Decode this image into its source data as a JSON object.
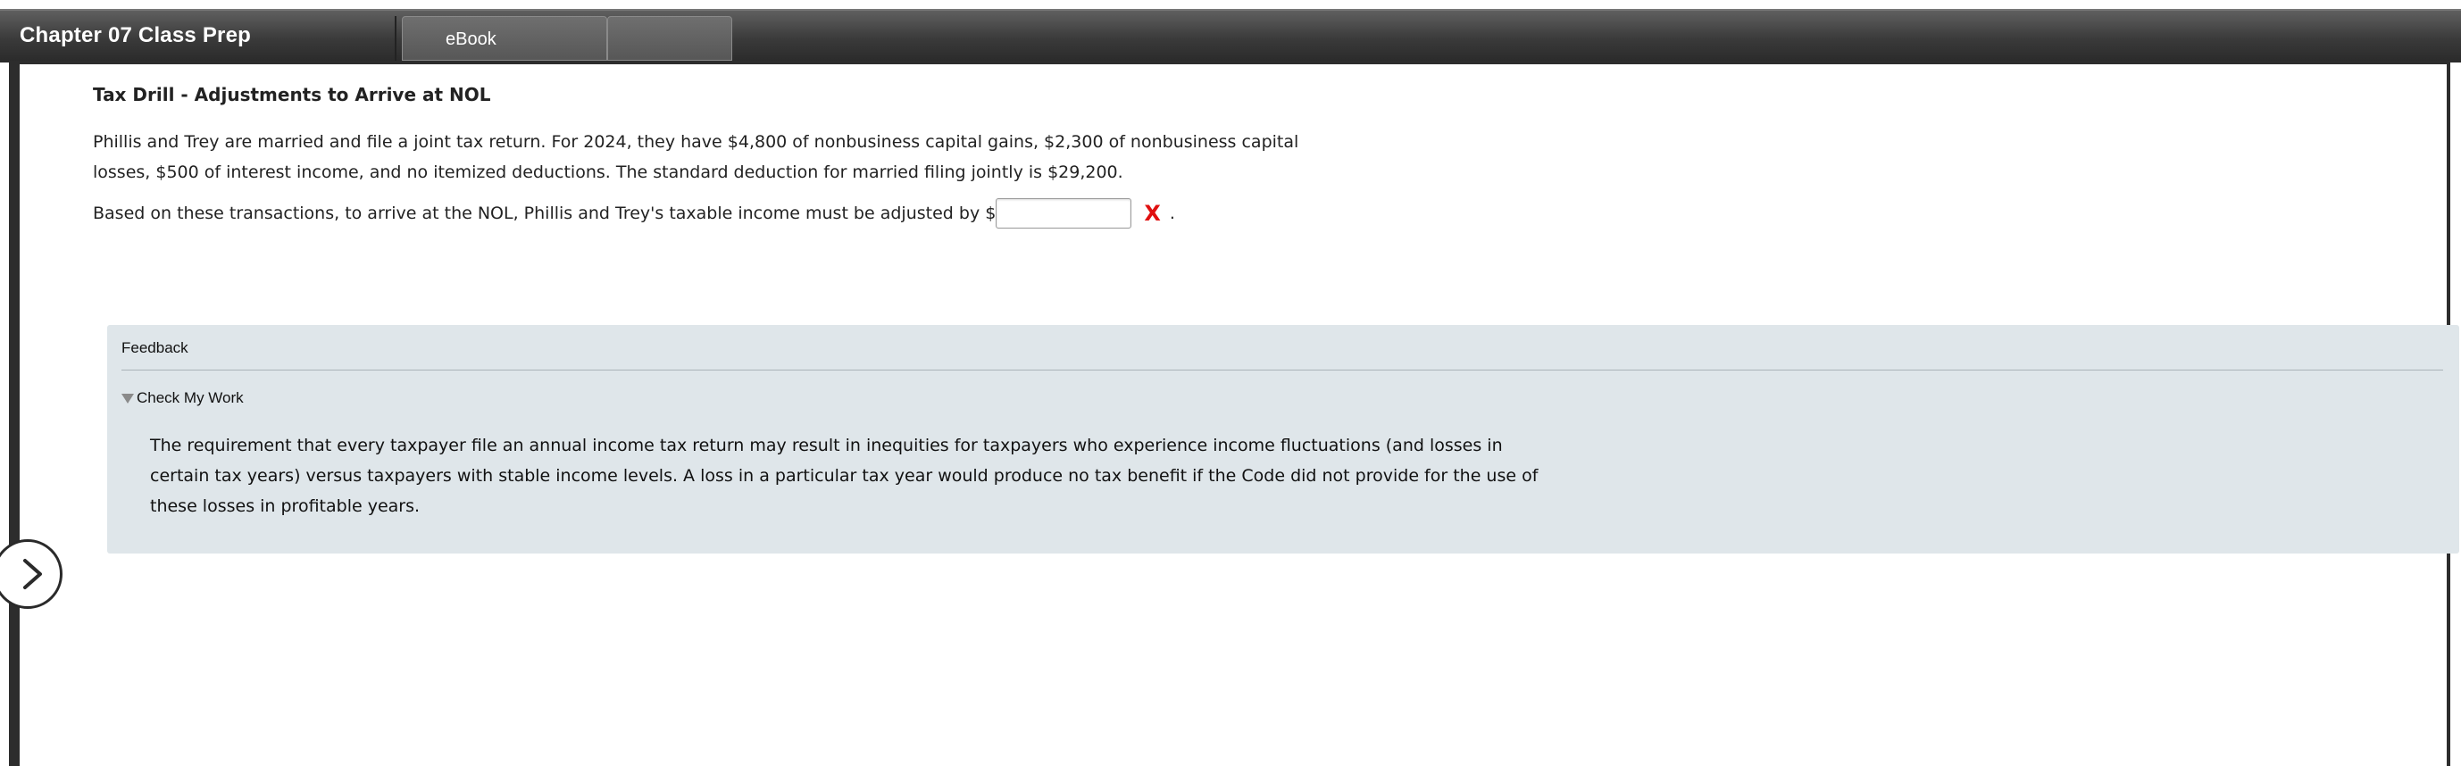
{
  "header": {
    "title": "Chapter 07 Class Prep",
    "tabs": [
      {
        "label": "eBook"
      },
      {
        "label": ""
      }
    ]
  },
  "question": {
    "title": "Tax Drill - Adjustments to Arrive at NOL",
    "text": "Phillis and Trey are married and file a joint tax return. For 2024, they have $4,800 of nonbusiness capital gains, $2,300 of nonbusiness capital losses, $500 of interest income, and no itemized deductions. The standard deduction for married filing jointly is $29,200.",
    "prompt_prefix": "Based on these transactions, to arrive at the NOL, Phillis and Trey's taxable income must be adjusted by $",
    "answer_value": "",
    "status_mark": "X",
    "prompt_suffix": "."
  },
  "feedback": {
    "title": "Feedback",
    "check_label": "Check My Work",
    "body": "The requirement that every taxpayer file an annual income tax return may result in inequities for taxpayers who experience income fluctuations (and losses in certain tax years) versus taxpayers with stable income levels. A loss in a particular tax year would produce no tax benefit if the Code did not provide for the use of these losses in profitable years."
  },
  "colors": {
    "incorrect": "#e01010",
    "feedback_bg": "#dfe6ea"
  },
  "icons": {
    "side_toggle": "chevron-right-icon",
    "expand": "triangle-down-icon"
  }
}
